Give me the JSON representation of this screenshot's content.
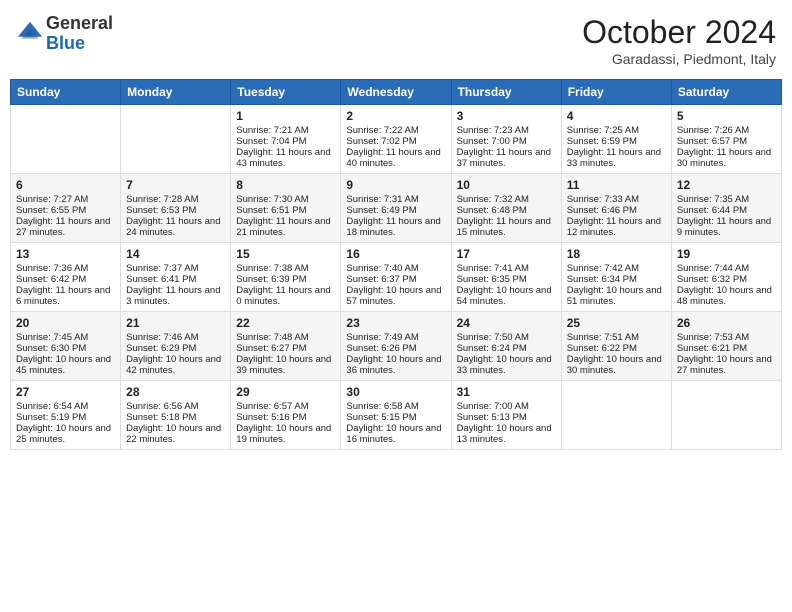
{
  "header": {
    "logo_general": "General",
    "logo_blue": "Blue",
    "month": "October 2024",
    "location": "Garadassi, Piedmont, Italy"
  },
  "days_of_week": [
    "Sunday",
    "Monday",
    "Tuesday",
    "Wednesday",
    "Thursday",
    "Friday",
    "Saturday"
  ],
  "weeks": [
    [
      {
        "day": "",
        "sunrise": "",
        "sunset": "",
        "daylight": ""
      },
      {
        "day": "",
        "sunrise": "",
        "sunset": "",
        "daylight": ""
      },
      {
        "day": "1",
        "sunrise": "Sunrise: 7:21 AM",
        "sunset": "Sunset: 7:04 PM",
        "daylight": "Daylight: 11 hours and 43 minutes."
      },
      {
        "day": "2",
        "sunrise": "Sunrise: 7:22 AM",
        "sunset": "Sunset: 7:02 PM",
        "daylight": "Daylight: 11 hours and 40 minutes."
      },
      {
        "day": "3",
        "sunrise": "Sunrise: 7:23 AM",
        "sunset": "Sunset: 7:00 PM",
        "daylight": "Daylight: 11 hours and 37 minutes."
      },
      {
        "day": "4",
        "sunrise": "Sunrise: 7:25 AM",
        "sunset": "Sunset: 6:59 PM",
        "daylight": "Daylight: 11 hours and 33 minutes."
      },
      {
        "day": "5",
        "sunrise": "Sunrise: 7:26 AM",
        "sunset": "Sunset: 6:57 PM",
        "daylight": "Daylight: 11 hours and 30 minutes."
      }
    ],
    [
      {
        "day": "6",
        "sunrise": "Sunrise: 7:27 AM",
        "sunset": "Sunset: 6:55 PM",
        "daylight": "Daylight: 11 hours and 27 minutes."
      },
      {
        "day": "7",
        "sunrise": "Sunrise: 7:28 AM",
        "sunset": "Sunset: 6:53 PM",
        "daylight": "Daylight: 11 hours and 24 minutes."
      },
      {
        "day": "8",
        "sunrise": "Sunrise: 7:30 AM",
        "sunset": "Sunset: 6:51 PM",
        "daylight": "Daylight: 11 hours and 21 minutes."
      },
      {
        "day": "9",
        "sunrise": "Sunrise: 7:31 AM",
        "sunset": "Sunset: 6:49 PM",
        "daylight": "Daylight: 11 hours and 18 minutes."
      },
      {
        "day": "10",
        "sunrise": "Sunrise: 7:32 AM",
        "sunset": "Sunset: 6:48 PM",
        "daylight": "Daylight: 11 hours and 15 minutes."
      },
      {
        "day": "11",
        "sunrise": "Sunrise: 7:33 AM",
        "sunset": "Sunset: 6:46 PM",
        "daylight": "Daylight: 11 hours and 12 minutes."
      },
      {
        "day": "12",
        "sunrise": "Sunrise: 7:35 AM",
        "sunset": "Sunset: 6:44 PM",
        "daylight": "Daylight: 11 hours and 9 minutes."
      }
    ],
    [
      {
        "day": "13",
        "sunrise": "Sunrise: 7:36 AM",
        "sunset": "Sunset: 6:42 PM",
        "daylight": "Daylight: 11 hours and 6 minutes."
      },
      {
        "day": "14",
        "sunrise": "Sunrise: 7:37 AM",
        "sunset": "Sunset: 6:41 PM",
        "daylight": "Daylight: 11 hours and 3 minutes."
      },
      {
        "day": "15",
        "sunrise": "Sunrise: 7:38 AM",
        "sunset": "Sunset: 6:39 PM",
        "daylight": "Daylight: 11 hours and 0 minutes."
      },
      {
        "day": "16",
        "sunrise": "Sunrise: 7:40 AM",
        "sunset": "Sunset: 6:37 PM",
        "daylight": "Daylight: 10 hours and 57 minutes."
      },
      {
        "day": "17",
        "sunrise": "Sunrise: 7:41 AM",
        "sunset": "Sunset: 6:35 PM",
        "daylight": "Daylight: 10 hours and 54 minutes."
      },
      {
        "day": "18",
        "sunrise": "Sunrise: 7:42 AM",
        "sunset": "Sunset: 6:34 PM",
        "daylight": "Daylight: 10 hours and 51 minutes."
      },
      {
        "day": "19",
        "sunrise": "Sunrise: 7:44 AM",
        "sunset": "Sunset: 6:32 PM",
        "daylight": "Daylight: 10 hours and 48 minutes."
      }
    ],
    [
      {
        "day": "20",
        "sunrise": "Sunrise: 7:45 AM",
        "sunset": "Sunset: 6:30 PM",
        "daylight": "Daylight: 10 hours and 45 minutes."
      },
      {
        "day": "21",
        "sunrise": "Sunrise: 7:46 AM",
        "sunset": "Sunset: 6:29 PM",
        "daylight": "Daylight: 10 hours and 42 minutes."
      },
      {
        "day": "22",
        "sunrise": "Sunrise: 7:48 AM",
        "sunset": "Sunset: 6:27 PM",
        "daylight": "Daylight: 10 hours and 39 minutes."
      },
      {
        "day": "23",
        "sunrise": "Sunrise: 7:49 AM",
        "sunset": "Sunset: 6:26 PM",
        "daylight": "Daylight: 10 hours and 36 minutes."
      },
      {
        "day": "24",
        "sunrise": "Sunrise: 7:50 AM",
        "sunset": "Sunset: 6:24 PM",
        "daylight": "Daylight: 10 hours and 33 minutes."
      },
      {
        "day": "25",
        "sunrise": "Sunrise: 7:51 AM",
        "sunset": "Sunset: 6:22 PM",
        "daylight": "Daylight: 10 hours and 30 minutes."
      },
      {
        "day": "26",
        "sunrise": "Sunrise: 7:53 AM",
        "sunset": "Sunset: 6:21 PM",
        "daylight": "Daylight: 10 hours and 27 minutes."
      }
    ],
    [
      {
        "day": "27",
        "sunrise": "Sunrise: 6:54 AM",
        "sunset": "Sunset: 5:19 PM",
        "daylight": "Daylight: 10 hours and 25 minutes."
      },
      {
        "day": "28",
        "sunrise": "Sunrise: 6:56 AM",
        "sunset": "Sunset: 5:18 PM",
        "daylight": "Daylight: 10 hours and 22 minutes."
      },
      {
        "day": "29",
        "sunrise": "Sunrise: 6:57 AM",
        "sunset": "Sunset: 5:16 PM",
        "daylight": "Daylight: 10 hours and 19 minutes."
      },
      {
        "day": "30",
        "sunrise": "Sunrise: 6:58 AM",
        "sunset": "Sunset: 5:15 PM",
        "daylight": "Daylight: 10 hours and 16 minutes."
      },
      {
        "day": "31",
        "sunrise": "Sunrise: 7:00 AM",
        "sunset": "Sunset: 5:13 PM",
        "daylight": "Daylight: 10 hours and 13 minutes."
      },
      {
        "day": "",
        "sunrise": "",
        "sunset": "",
        "daylight": ""
      },
      {
        "day": "",
        "sunrise": "",
        "sunset": "",
        "daylight": ""
      }
    ]
  ]
}
